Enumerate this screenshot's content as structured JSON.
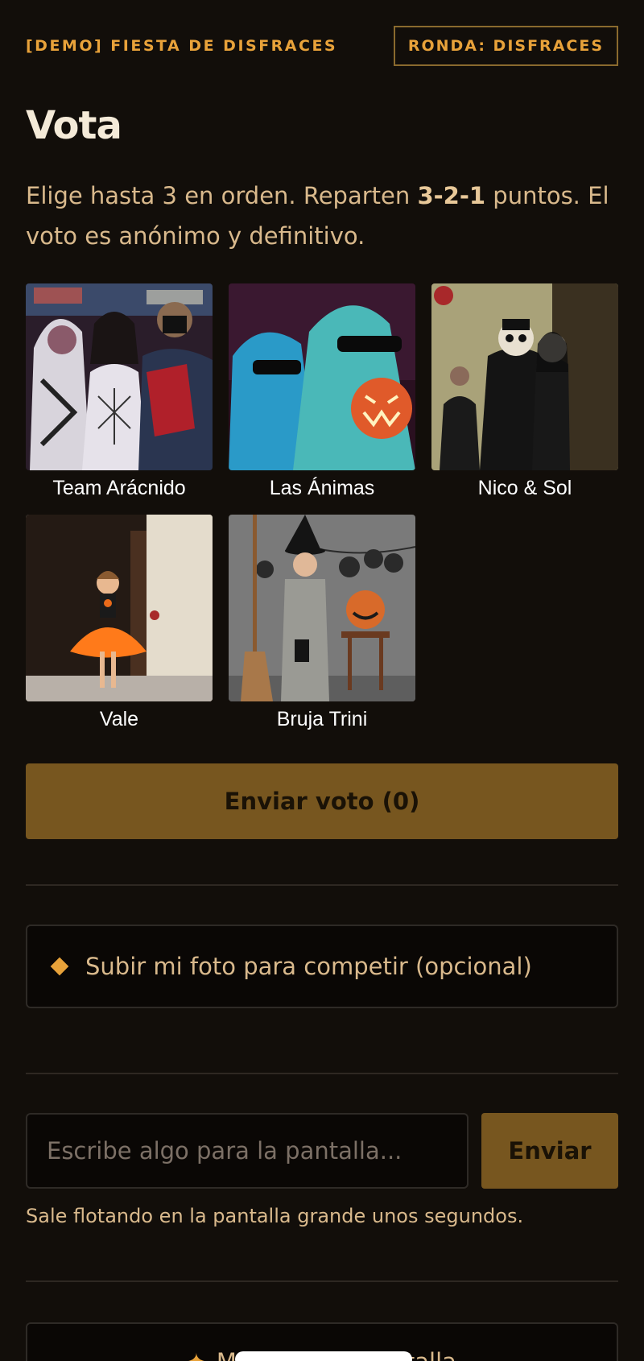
{
  "header": {
    "event_name": "[DEMO] FIESTA DE DISFRACES",
    "round_badge": "RONDA: DISFRACES"
  },
  "vote": {
    "title": "Vota",
    "instructions_before": "Elige hasta 3 en orden. Reparten ",
    "instructions_points": "3-2-1",
    "instructions_after": " puntos. El voto es anónimo y definitivo."
  },
  "contestants": [
    {
      "name": "Team Arácnido"
    },
    {
      "name": "Las Ánimas"
    },
    {
      "name": "Nico & Sol"
    },
    {
      "name": "Vale"
    },
    {
      "name": "Bruja Trini"
    }
  ],
  "submit_vote_label": "Enviar voto (0)",
  "upload": {
    "label": "Subir mi foto para competir (opcional)"
  },
  "message": {
    "placeholder": "Escribe algo para la pantalla...",
    "send_label": "Enviar",
    "helper": "Sale flotando en la pantalla grande unos segundos."
  },
  "bottom": {
    "label": "Mandar a la pantalla"
  },
  "colors": {
    "background": "#120e0a",
    "accent": "#e8a23a",
    "button": "#77561f",
    "text": "#d9b98c"
  }
}
